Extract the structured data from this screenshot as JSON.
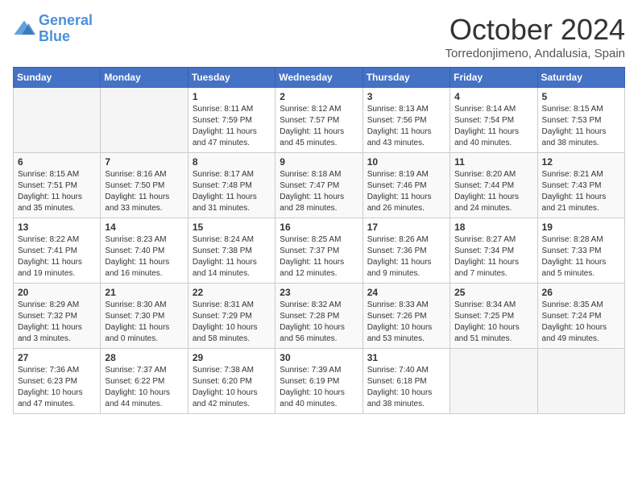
{
  "header": {
    "logo_general": "General",
    "logo_blue": "Blue",
    "month_title": "October 2024",
    "subtitle": "Torredonjimeno, Andalusia, Spain"
  },
  "weekdays": [
    "Sunday",
    "Monday",
    "Tuesday",
    "Wednesday",
    "Thursday",
    "Friday",
    "Saturday"
  ],
  "weeks": [
    [
      {
        "day": "",
        "empty": true
      },
      {
        "day": "",
        "empty": true
      },
      {
        "day": "1",
        "sunrise": "8:11 AM",
        "sunset": "7:59 PM",
        "daylight": "11 hours and 47 minutes."
      },
      {
        "day": "2",
        "sunrise": "8:12 AM",
        "sunset": "7:57 PM",
        "daylight": "11 hours and 45 minutes."
      },
      {
        "day": "3",
        "sunrise": "8:13 AM",
        "sunset": "7:56 PM",
        "daylight": "11 hours and 43 minutes."
      },
      {
        "day": "4",
        "sunrise": "8:14 AM",
        "sunset": "7:54 PM",
        "daylight": "11 hours and 40 minutes."
      },
      {
        "day": "5",
        "sunrise": "8:15 AM",
        "sunset": "7:53 PM",
        "daylight": "11 hours and 38 minutes."
      }
    ],
    [
      {
        "day": "6",
        "sunrise": "8:15 AM",
        "sunset": "7:51 PM",
        "daylight": "11 hours and 35 minutes."
      },
      {
        "day": "7",
        "sunrise": "8:16 AM",
        "sunset": "7:50 PM",
        "daylight": "11 hours and 33 minutes."
      },
      {
        "day": "8",
        "sunrise": "8:17 AM",
        "sunset": "7:48 PM",
        "daylight": "11 hours and 31 minutes."
      },
      {
        "day": "9",
        "sunrise": "8:18 AM",
        "sunset": "7:47 PM",
        "daylight": "11 hours and 28 minutes."
      },
      {
        "day": "10",
        "sunrise": "8:19 AM",
        "sunset": "7:46 PM",
        "daylight": "11 hours and 26 minutes."
      },
      {
        "day": "11",
        "sunrise": "8:20 AM",
        "sunset": "7:44 PM",
        "daylight": "11 hours and 24 minutes."
      },
      {
        "day": "12",
        "sunrise": "8:21 AM",
        "sunset": "7:43 PM",
        "daylight": "11 hours and 21 minutes."
      }
    ],
    [
      {
        "day": "13",
        "sunrise": "8:22 AM",
        "sunset": "7:41 PM",
        "daylight": "11 hours and 19 minutes."
      },
      {
        "day": "14",
        "sunrise": "8:23 AM",
        "sunset": "7:40 PM",
        "daylight": "11 hours and 16 minutes."
      },
      {
        "day": "15",
        "sunrise": "8:24 AM",
        "sunset": "7:38 PM",
        "daylight": "11 hours and 14 minutes."
      },
      {
        "day": "16",
        "sunrise": "8:25 AM",
        "sunset": "7:37 PM",
        "daylight": "11 hours and 12 minutes."
      },
      {
        "day": "17",
        "sunrise": "8:26 AM",
        "sunset": "7:36 PM",
        "daylight": "11 hours and 9 minutes."
      },
      {
        "day": "18",
        "sunrise": "8:27 AM",
        "sunset": "7:34 PM",
        "daylight": "11 hours and 7 minutes."
      },
      {
        "day": "19",
        "sunrise": "8:28 AM",
        "sunset": "7:33 PM",
        "daylight": "11 hours and 5 minutes."
      }
    ],
    [
      {
        "day": "20",
        "sunrise": "8:29 AM",
        "sunset": "7:32 PM",
        "daylight": "11 hours and 3 minutes."
      },
      {
        "day": "21",
        "sunrise": "8:30 AM",
        "sunset": "7:30 PM",
        "daylight": "11 hours and 0 minutes."
      },
      {
        "day": "22",
        "sunrise": "8:31 AM",
        "sunset": "7:29 PM",
        "daylight": "10 hours and 58 minutes."
      },
      {
        "day": "23",
        "sunrise": "8:32 AM",
        "sunset": "7:28 PM",
        "daylight": "10 hours and 56 minutes."
      },
      {
        "day": "24",
        "sunrise": "8:33 AM",
        "sunset": "7:26 PM",
        "daylight": "10 hours and 53 minutes."
      },
      {
        "day": "25",
        "sunrise": "8:34 AM",
        "sunset": "7:25 PM",
        "daylight": "10 hours and 51 minutes."
      },
      {
        "day": "26",
        "sunrise": "8:35 AM",
        "sunset": "7:24 PM",
        "daylight": "10 hours and 49 minutes."
      }
    ],
    [
      {
        "day": "27",
        "sunrise": "7:36 AM",
        "sunset": "6:23 PM",
        "daylight": "10 hours and 47 minutes."
      },
      {
        "day": "28",
        "sunrise": "7:37 AM",
        "sunset": "6:22 PM",
        "daylight": "10 hours and 44 minutes."
      },
      {
        "day": "29",
        "sunrise": "7:38 AM",
        "sunset": "6:20 PM",
        "daylight": "10 hours and 42 minutes."
      },
      {
        "day": "30",
        "sunrise": "7:39 AM",
        "sunset": "6:19 PM",
        "daylight": "10 hours and 40 minutes."
      },
      {
        "day": "31",
        "sunrise": "7:40 AM",
        "sunset": "6:18 PM",
        "daylight": "10 hours and 38 minutes."
      },
      {
        "day": "",
        "empty": true
      },
      {
        "day": "",
        "empty": true
      }
    ]
  ],
  "labels": {
    "sunrise": "Sunrise:",
    "sunset": "Sunset:",
    "daylight": "Daylight:"
  }
}
